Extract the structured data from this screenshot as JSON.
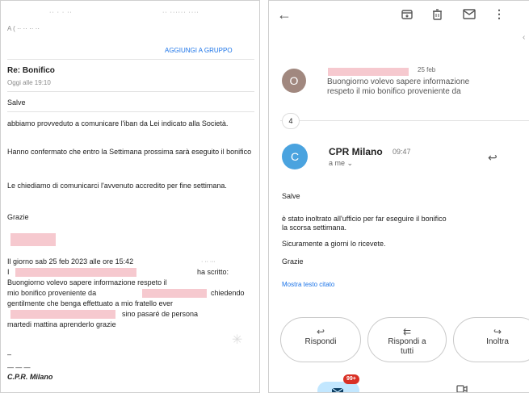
{
  "left": {
    "header_line": "A ( ·· ·· ·· ··",
    "add_group": "AGGIUNGI A GRUPPO",
    "subject": "Re: Bonifico",
    "date": "Oggi alle 19:10",
    "greeting": "Salve",
    "p1": "abbiamo provveduto a comunicare l'iban da Lei indicato alla Società.",
    "p2": "Hanno confermato che entro la Settimana prossima sarà eseguito il bonifico",
    "p3": "Le chiediamo di comunicarci l'avvenuto accredito per fine settimana.",
    "thanks": "Grazie",
    "quote_l1": "Il giorno sab 25 feb 2023 alle ore 15:42",
    "quote_l2": "ha scritto:",
    "quote_l3": "Buongiorno volevo sapere informazione respeto il",
    "quote_l4a": "mio bonifico proveniente da",
    "quote_l4b": "chiedendo",
    "quote_l5": "gentilmente che benga effettuato a mio fratello ever",
    "quote_l6": "sino pasaré de persona",
    "quote_l7": "martedi mattina aprenderlo grazie",
    "sig_dash": "–",
    "sig_line": "— — —",
    "signature": "C.P.R. Milano"
  },
  "right": {
    "first_msg_date": "25 feb",
    "first_msg_avatar": "O",
    "first_msg_snippet_l1": "Buongiorno volevo sapere informazione",
    "first_msg_snippet_l2": "respeto il mio bonifico proveniente da",
    "collapsed_count": "4",
    "sender_avatar": "C",
    "sender_name": "CPR Milano",
    "sender_time": "09:47",
    "recipient": "a me",
    "greeting": "Salve",
    "body_l1": "è stato inoltrato all'ufficio per far eseguire il bonifico",
    "body_l2": "la scorsa settimana.",
    "body_l3": "Sicuramente a giorni lo ricevete.",
    "thanks": "Grazie",
    "show_quoted": "Mostra testo citato",
    "reply": "Rispondi",
    "reply_all_l1": "Rispondi a",
    "reply_all_l2": "tutti",
    "forward": "Inoltra",
    "badge": "99+",
    "colors": {
      "accent": "#1a73e8",
      "avatar_o": "#a1887f",
      "avatar_c": "#4aa3df",
      "badge": "#d93025"
    }
  }
}
